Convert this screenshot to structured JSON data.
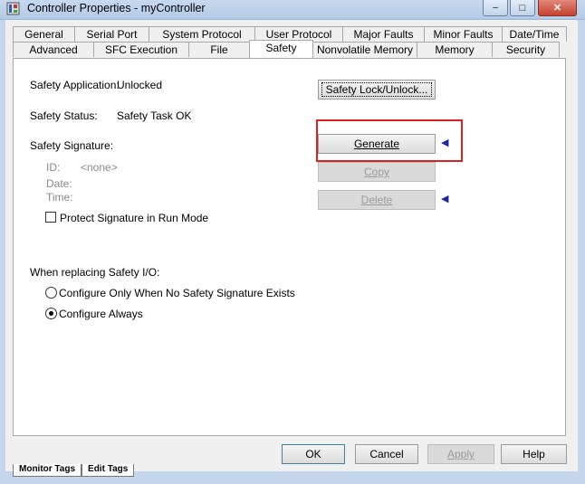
{
  "window": {
    "title": "Controller Properties - myController",
    "minimize": "–",
    "maximize": "□",
    "close": "✕"
  },
  "tabs_back": [
    "General",
    "Serial Port",
    "System Protocol",
    "User Protocol",
    "Major Faults",
    "Minor Faults",
    "Date/Time"
  ],
  "tabs_front": [
    "Advanced",
    "SFC Execution",
    "File",
    "Safety",
    "Nonvolatile Memory",
    "Memory",
    "Security"
  ],
  "active_tab": "Safety",
  "safety": {
    "application_label": "Safety Application:",
    "application_value": "Unlocked",
    "status_label": "Safety Status:",
    "status_value": "Safety Task OK",
    "signature_label": "Safety Signature:",
    "id_label": "ID:",
    "id_value": "<none>",
    "date_label": "Date:",
    "time_label": "Time:",
    "protect_checkbox": "Protect Signature in Run Mode",
    "protect_checked": false,
    "lock_button": "Safety Lock/Unlock...",
    "generate_button": "Generate",
    "copy_button": "Copy",
    "delete_button": "Delete",
    "replacing_label": "When replacing Safety I/O:",
    "option_no_sig": "Configure Only When No Safety Signature Exists",
    "option_always": "Configure Always",
    "selected_option": "Configure Always"
  },
  "footer": {
    "ok": "OK",
    "cancel": "Cancel",
    "apply": "Apply",
    "help": "Help"
  },
  "background_tabs": [
    "Monitor Tags",
    "Edit Tags"
  ]
}
